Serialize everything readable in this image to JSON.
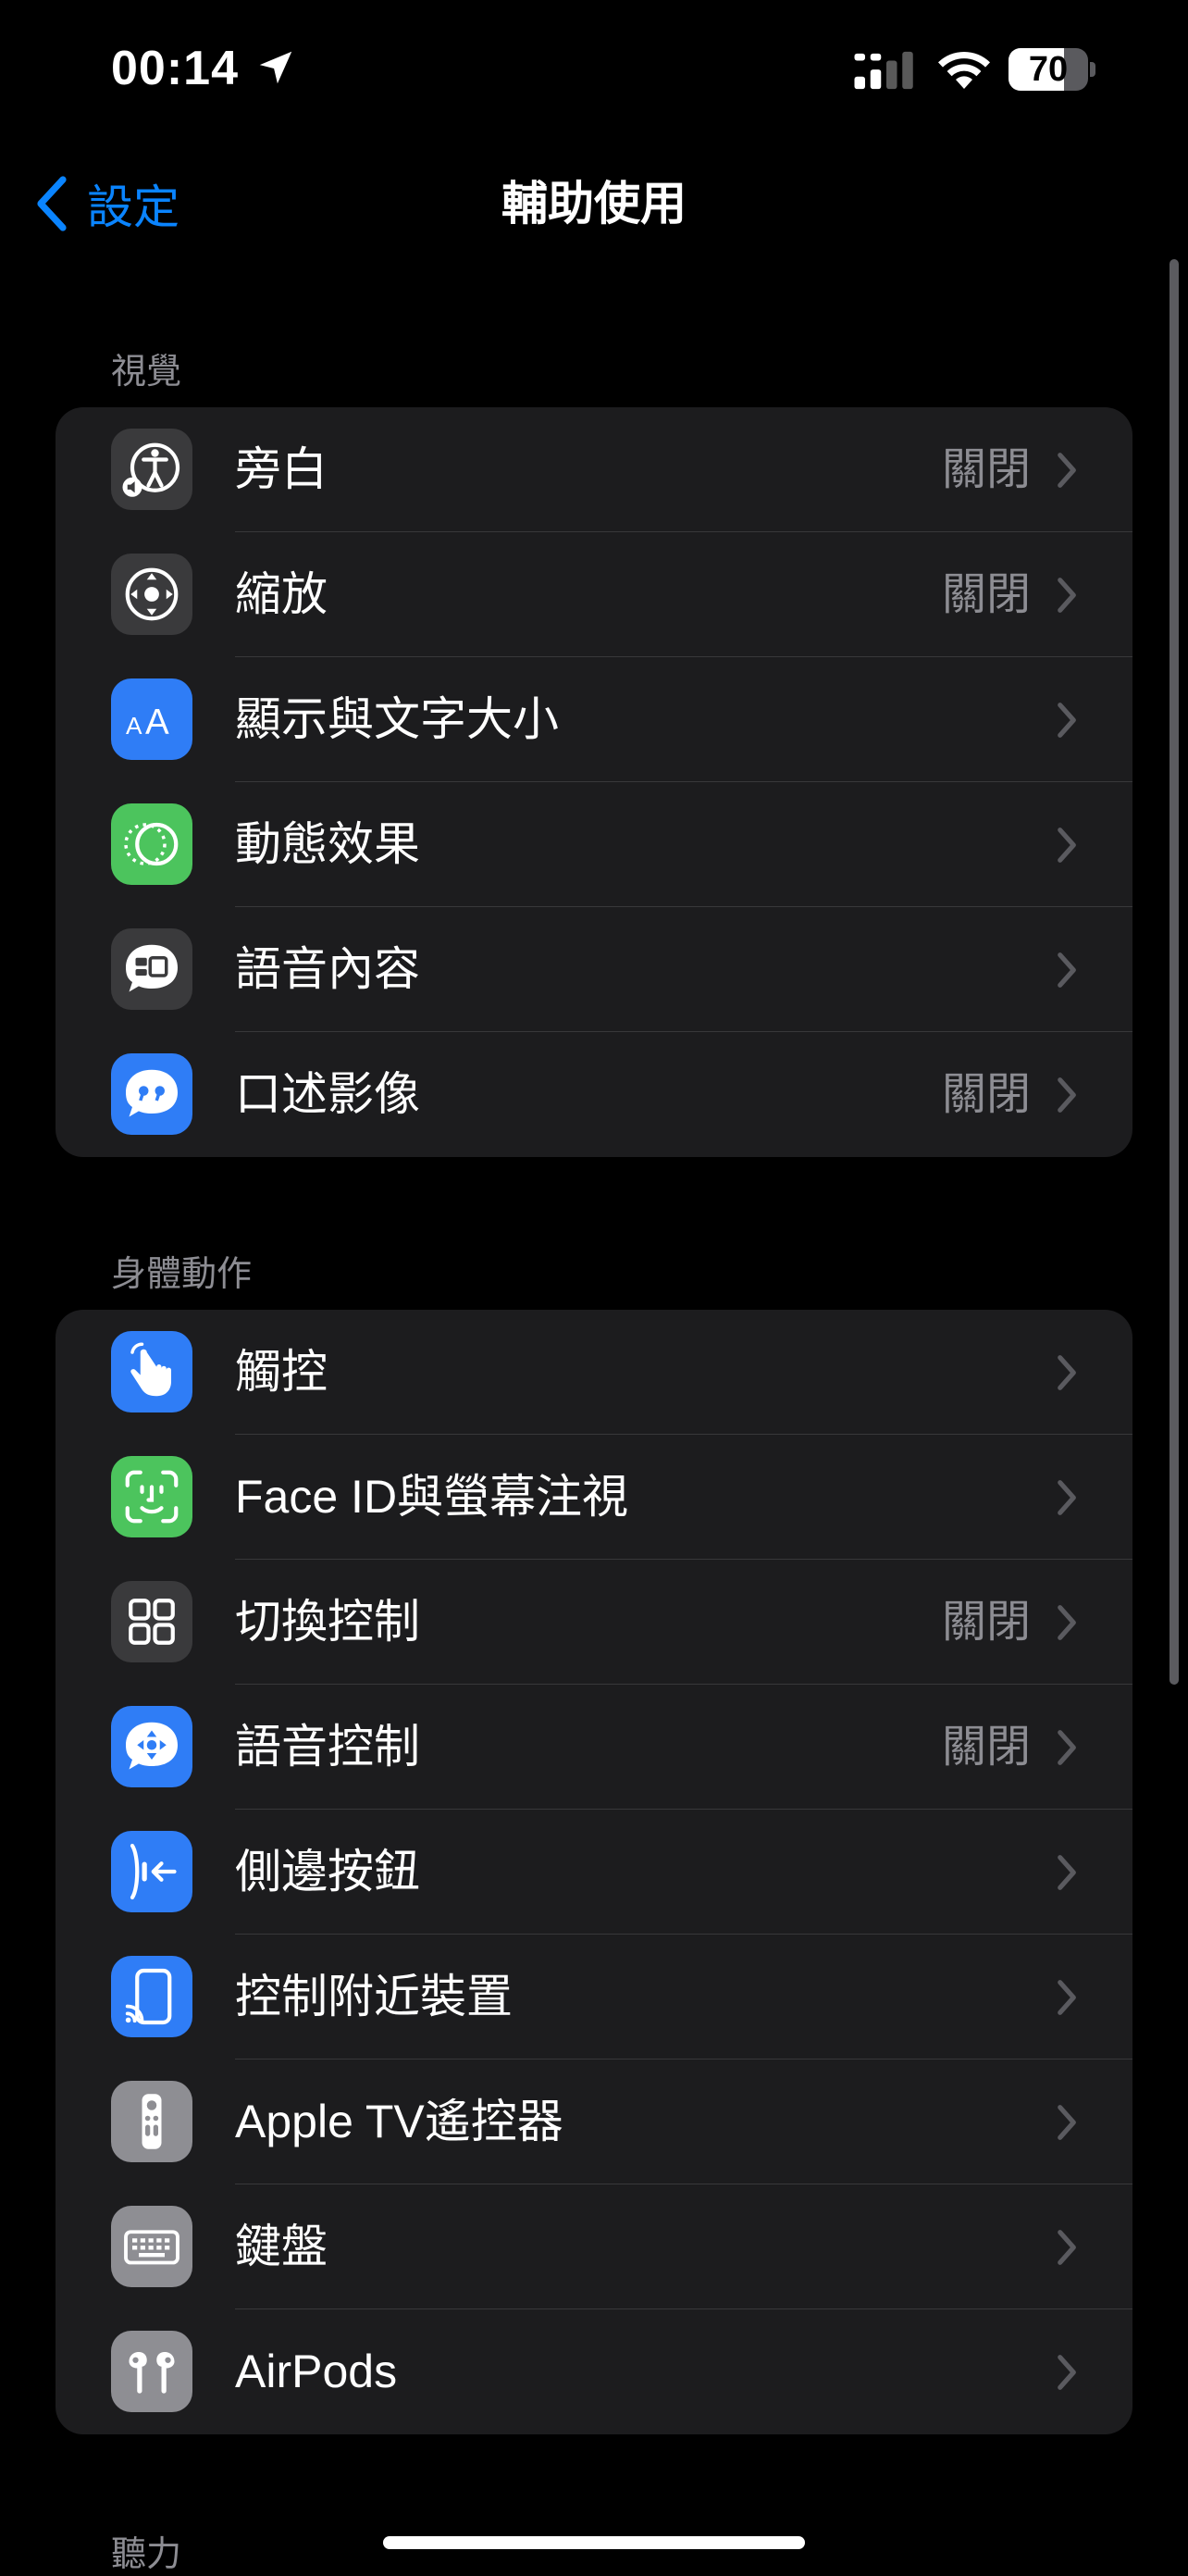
{
  "status": {
    "time": "00:14",
    "battery": "70",
    "battery_level": 0.7
  },
  "nav": {
    "back_label": "設定",
    "title": "輔助使用"
  },
  "sections": [
    {
      "header": "視覺",
      "items": [
        {
          "label": "旁白",
          "value": "關閉",
          "icon": "voiceover-icon",
          "color": "#3a3a3c"
        },
        {
          "label": "縮放",
          "value": "關閉",
          "icon": "zoom-icon",
          "color": "#3a3a3c"
        },
        {
          "label": "顯示與文字大小",
          "value": "",
          "icon": "text-size-icon",
          "color": "#2f7df6"
        },
        {
          "label": "動態效果",
          "value": "",
          "icon": "motion-icon",
          "color": "#4cc45d"
        },
        {
          "label": "語音內容",
          "value": "",
          "icon": "spoken-content-icon",
          "color": "#3a3a3c"
        },
        {
          "label": "口述影像",
          "value": "關閉",
          "icon": "audio-description-icon",
          "color": "#2f7df6"
        }
      ]
    },
    {
      "header": "身體動作",
      "items": [
        {
          "label": "觸控",
          "value": "",
          "icon": "touch-hand-icon",
          "color": "#2f7df6"
        },
        {
          "label": "Face ID與螢幕注視",
          "value": "",
          "icon": "face-id-icon",
          "color": "#4cc45d"
        },
        {
          "label": "切換控制",
          "value": "關閉",
          "icon": "switch-control-icon",
          "color": "#3a3a3c"
        },
        {
          "label": "語音控制",
          "value": "關閉",
          "icon": "voice-control-icon",
          "color": "#2f7df6"
        },
        {
          "label": "側邊按鈕",
          "value": "",
          "icon": "side-button-icon",
          "color": "#2f7df6"
        },
        {
          "label": "控制附近裝置",
          "value": "",
          "icon": "nearby-devices-icon",
          "color": "#2f7df6"
        },
        {
          "label": "Apple TV遙控器",
          "value": "",
          "icon": "tv-remote-icon",
          "color": "#8e8e93"
        },
        {
          "label": "鍵盤",
          "value": "",
          "icon": "keyboard-icon",
          "color": "#8e8e93"
        },
        {
          "label": "AirPods",
          "value": "",
          "icon": "airpods-icon",
          "color": "#8e8e93"
        }
      ]
    },
    {
      "header": "聽力",
      "items": []
    }
  ]
}
